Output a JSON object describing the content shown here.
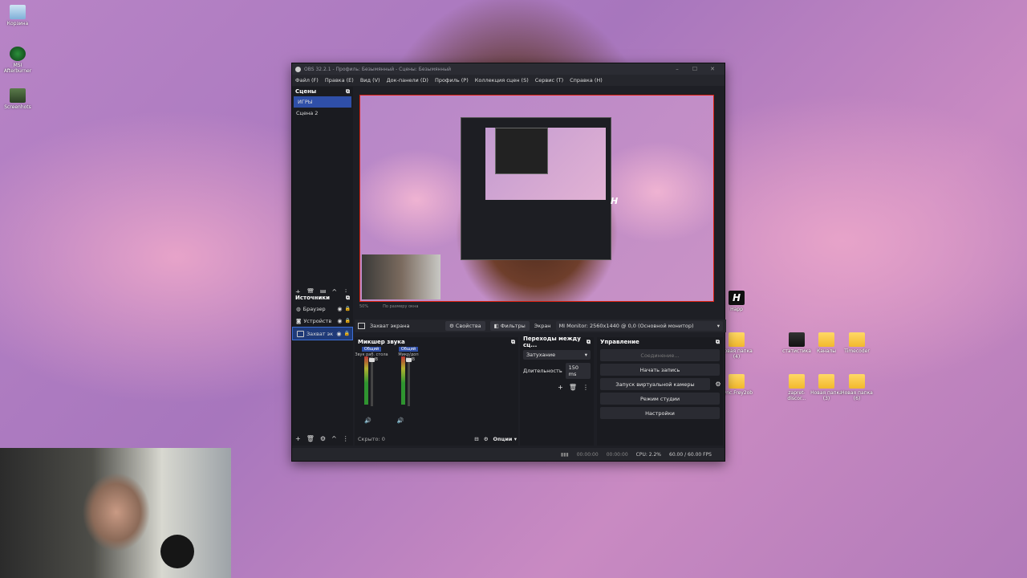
{
  "desktop": {
    "icons_left": [
      {
        "label": "Корзина"
      },
      {
        "label": "MSI Afterburner"
      },
      {
        "label": "Screenhots"
      }
    ],
    "icons_right": [
      {
        "label": "Happ"
      },
      {
        "label": "Новая папка (4)"
      },
      {
        "label": "статистика"
      },
      {
        "label": "Каналы"
      },
      {
        "label": "Timecoder"
      },
      {
        "label": "Sync.Frey2ob"
      },
      {
        "label": "zapret-discor..."
      },
      {
        "label": "Новая папка (3)"
      },
      {
        "label": "Новая папка (6)"
      }
    ]
  },
  "obs": {
    "title": "OBS 32.2.1 - Профиль: Безымянный - Сцены: Безымянный",
    "menu": [
      "Файл (F)",
      "Правка (E)",
      "Вид (V)",
      "Док-панели (D)",
      "Профиль (P)",
      "Коллекция сцен (S)",
      "Сервис (T)",
      "Справка (H)"
    ],
    "scenes": {
      "title": "Сцены",
      "items": [
        "ИГРЫ",
        "Сцена 2"
      ]
    },
    "preview": {
      "zoom": "50%",
      "scale_mode": "По размеру окна"
    },
    "sources": {
      "title": "Источники",
      "items": [
        "Браузер",
        "Устройств",
        "Захват эк"
      ]
    },
    "context": {
      "source_name": "Захват экрана",
      "properties": "Свойства",
      "filters": "Фильтры",
      "screen_label": "Экран",
      "screen_value": "MI Monitor: 2560x1440 @ 0,0 (Основной монитор)"
    },
    "mixer": {
      "title": "Микшер звука",
      "channels": [
        {
          "tag": "Общий",
          "name": "Звук раб. стола",
          "db": "0.0 dB"
        },
        {
          "tag": "Общий",
          "name": "Микр/доп",
          "db": "0.0 dB"
        }
      ],
      "hidden": "Скрыто: 0",
      "options": "Опции"
    },
    "transitions": {
      "title": "Переходы между сц...",
      "type": "Затухание",
      "duration_label": "Длительность",
      "duration_value": "150 ms"
    },
    "controls": {
      "title": "Управление",
      "connection": "Соединение...",
      "record": "Начать запись",
      "virtual_cam": "Запуск виртуальной камеры",
      "studio": "Режим студии",
      "settings": "Настройки"
    },
    "status": {
      "stream_time": "00:00:00",
      "rec_time": "00:00:00",
      "cpu": "CPU: 2.2%",
      "fps": "60.00 / 60.00 FPS"
    }
  },
  "colors": {
    "accent": "#2f4fa8",
    "preview_border": "#dd2211"
  }
}
